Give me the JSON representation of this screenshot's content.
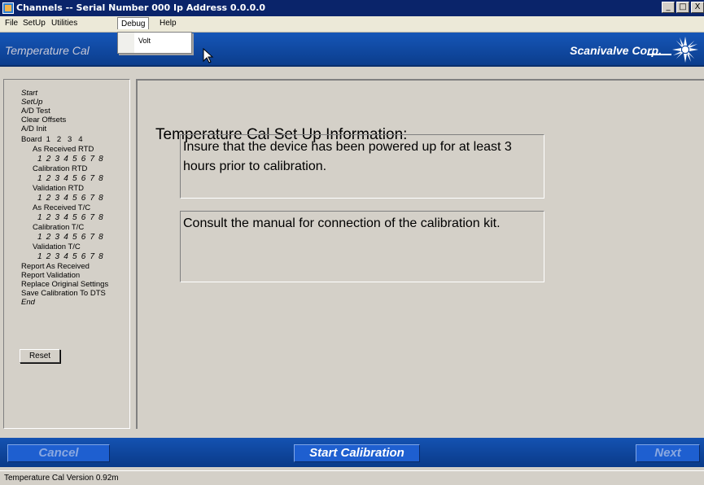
{
  "window": {
    "title": "Channels -- Serial Number 000  Ip Address 0.0.0.0",
    "min_glyph": "_",
    "max_glyph": "□",
    "close_glyph": "X"
  },
  "menu": {
    "items": [
      "File",
      "SetUp",
      "Utilities",
      "Debug",
      "Help"
    ],
    "active": "Debug",
    "debug_dropdown": [
      "Volt"
    ]
  },
  "header": {
    "title": "Temperature Cal",
    "brand": "Scanivalve Corp."
  },
  "sidebar": {
    "items": [
      "Start",
      "SetUp",
      "A/D Test",
      "Clear Offsets",
      "A/D Init",
      "Board  1   2   3   4",
      "As Received RTD",
      "1 2 3 4 5 6 7 8",
      "Calibration RTD",
      "1 2 3 4 5 6 7 8",
      "Validation RTD",
      "1 2 3 4 5 6 7 8",
      "As Received T/C",
      "1 2 3 4 5 6 7 8",
      "Calibration T/C",
      "1 2 3 4 5 6 7 8",
      "Validation T/C",
      "1 2 3 4 5 6 7 8",
      "Report As Received",
      "Report Validation",
      "Replace Original Settings",
      "Save Calibration To DTS",
      "End"
    ],
    "reset_label": "Reset"
  },
  "main": {
    "heading": "Temperature Cal Set Up Information:",
    "info1": "Insure that the device has been powered up for at least 3 hours prior to calibration.",
    "info2": "Consult the manual for connection of the calibration kit."
  },
  "buttons": {
    "cancel": "Cancel",
    "start": "Start Calibration",
    "next": "Next"
  },
  "status": {
    "text": "Temperature Cal Version 0.92m"
  },
  "colors": {
    "header_blue": "#1656b8",
    "button_blue": "#1e5fd0",
    "disabled_text": "#8aa8e0"
  }
}
